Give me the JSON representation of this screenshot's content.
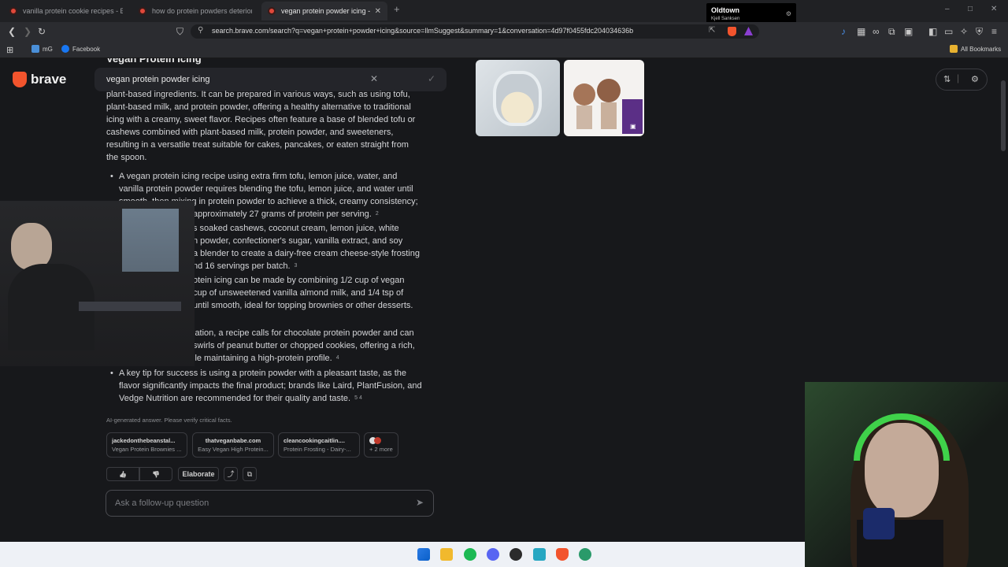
{
  "tabs": [
    {
      "title": "vanilla protein cookie recipes - Brave",
      "active": false
    },
    {
      "title": "how do protein powders deteriorate",
      "active": false
    },
    {
      "title": "vegan protein powder icing - Br",
      "active": true
    }
  ],
  "new_tab": "+",
  "window_controls": {
    "minimize": "–",
    "maximize": "□",
    "close": "✕"
  },
  "address_bar": {
    "url": "search.brave.com/search?q=vegan+protein+powder+icing&source=llmSuggest&summary=1&conversation=4d97f0455fdc204034636b"
  },
  "bookmarks": {
    "items": [
      {
        "label": "mG",
        "color": "#4a8fd8"
      },
      {
        "label": "Facebook",
        "color": "#1877f2"
      }
    ],
    "all_bookmarks": "All Bookmarks"
  },
  "notification": {
    "title": "Oldtown",
    "subtitle": "Kjell Sanksen"
  },
  "brand": {
    "name": "brave",
    "accent": "#f2542d"
  },
  "search": {
    "query": "vegan protein powder icing",
    "clear": "✕",
    "submit": "✓"
  },
  "answer": {
    "heading": "Vegan Protein Icing",
    "intro_lines": [
      "plant-based ingredients. It can be prepared in various ways, such as using tofu,",
      "plant-based milk, and protein powder, offering a healthy alternative to traditional",
      "icing with a creamy, sweet flavor. Recipes often feature a base of blended tofu or",
      "cashews combined with plant-based milk, protein powder, and sweeteners,",
      "resulting in a versatile treat suitable for cakes, pancakes, or eaten straight from",
      "the spoon."
    ],
    "bullets": [
      {
        "lines": [
          "A vegan protein icing recipe using extra firm tofu, lemon juice, water, and",
          "vanilla protein powder requires blending the tofu, lemon juice, and water until",
          "smooth, then mixing in protein powder to achieve a thick, creamy consistency;",
          "approximately 27 grams of protein per serving."
        ],
        "ref": "2"
      },
      {
        "lines": [
          "s soaked cashews, coconut cream, lemon juice, white",
          "n powder, confectioner's sugar, vanilla extract, and soy",
          "a blender to create a dairy-free cream cheese-style frosting",
          "nd 16 servings per batch."
        ],
        "ref": "3"
      },
      {
        "lines": [
          "otein icing can be made by combining 1/2 cup of vegan",
          "cup of unsweetened vanilla almond milk, and 1/4 tsp of",
          "until smooth, ideal for topping brownies or other desserts."
        ],
        "ref": ""
      },
      {
        "lines": [
          "iation, a recipe calls for chocolate protein powder and can",
          "swirls of peanut butter or chopped cookies, offering a rich,",
          "ile maintaining a high-protein profile."
        ],
        "ref": "4"
      },
      {
        "lines": [
          "A key tip for success is using a protein powder with a pleasant taste, as the",
          "flavor significantly impacts the final product; brands like Laird, PlantFusion, and",
          "Vedge Nutrition are recommended for their quality and taste."
        ],
        "ref": "5  4"
      }
    ],
    "disclaimer": "AI-generated answer. Please verify critical facts."
  },
  "sources": [
    {
      "domain": "jackedonthebeanstal...",
      "title": "Vegan Protein Brownies ..."
    },
    {
      "domain": "thatveganbabe.com",
      "title": "Easy Vegan High Protein..."
    },
    {
      "domain": "cleancookingcaitlin....",
      "title": "Protein Frosting - Dairy-..."
    },
    {
      "domain": "",
      "title": "+ 2 more"
    }
  ],
  "actions": {
    "thumbs_up": "👍",
    "thumbs_down": "👎",
    "elaborate": "Elaborate",
    "share": "⤴",
    "copy": "⧉"
  },
  "followup": {
    "placeholder": "Ask a follow-up question",
    "send": "➤"
  }
}
